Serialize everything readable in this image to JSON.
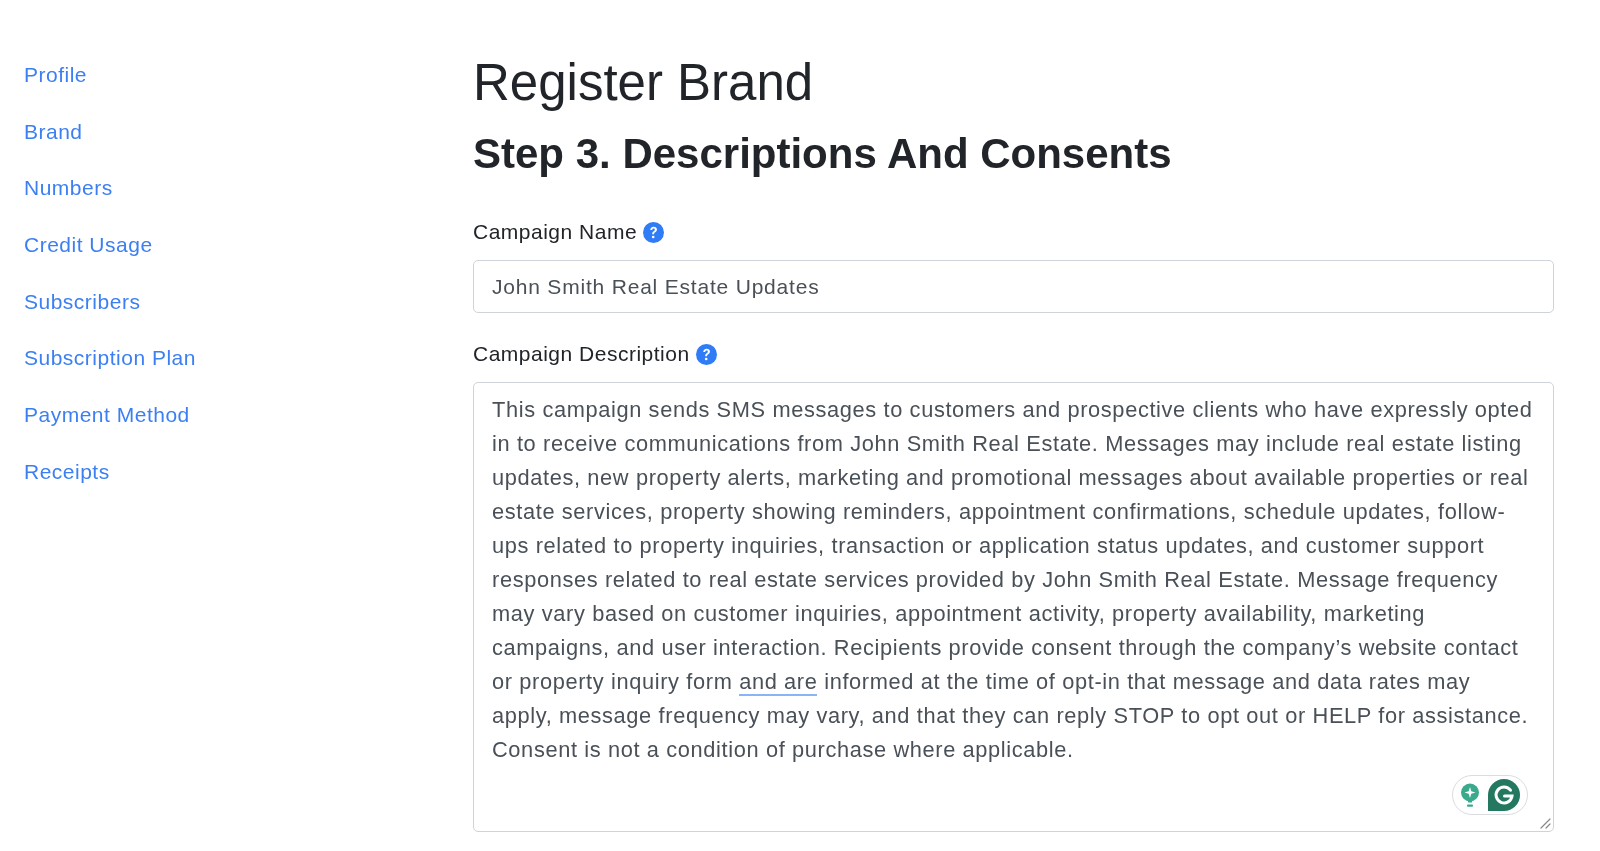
{
  "sidebar": {
    "items": [
      {
        "label": "Profile"
      },
      {
        "label": "Brand"
      },
      {
        "label": "Numbers"
      },
      {
        "label": "Credit Usage"
      },
      {
        "label": "Subscribers"
      },
      {
        "label": "Subscription Plan"
      },
      {
        "label": "Payment Method"
      },
      {
        "label": "Receipts"
      }
    ]
  },
  "page": {
    "title": "Register Brand",
    "step_title": "Step 3. Descriptions And Consents"
  },
  "form": {
    "fields": [
      {
        "kind": "text",
        "label": "Campaign Name",
        "value": "John Smith Real Estate Updates"
      },
      {
        "kind": "textarea",
        "label": "Campaign Description",
        "value_parts": [
          {
            "text": "This campaign sends SMS messages to customers and prospective clients who have expressly opted in to receive communications from John Smith Real Estate. Messages may include real estate listing updates, new property alerts, marketing and promotional messages about available properties or real estate services, property showing reminders, appointment confirmations, schedule updates, follow-ups related to property inquiries, transaction or application status updates, and customer support responses related to real estate services provided by John Smith Real Estate. Message frequency may vary based on customer inquiries, appointment activity, property availability, marketing campaigns, and user interaction. Recipients provide consent through the company’s website contact or property inquiry form ",
            "flagged": false
          },
          {
            "text": "and are",
            "flagged": true
          },
          {
            "text": " informed at the time of opt-in that message and data rates may apply, message frequency may vary, and that they can reply STOP to opt out or HELP for assistance. Consent is not a condition of purchase where applicable.",
            "flagged": false
          }
        ]
      }
    ]
  }
}
